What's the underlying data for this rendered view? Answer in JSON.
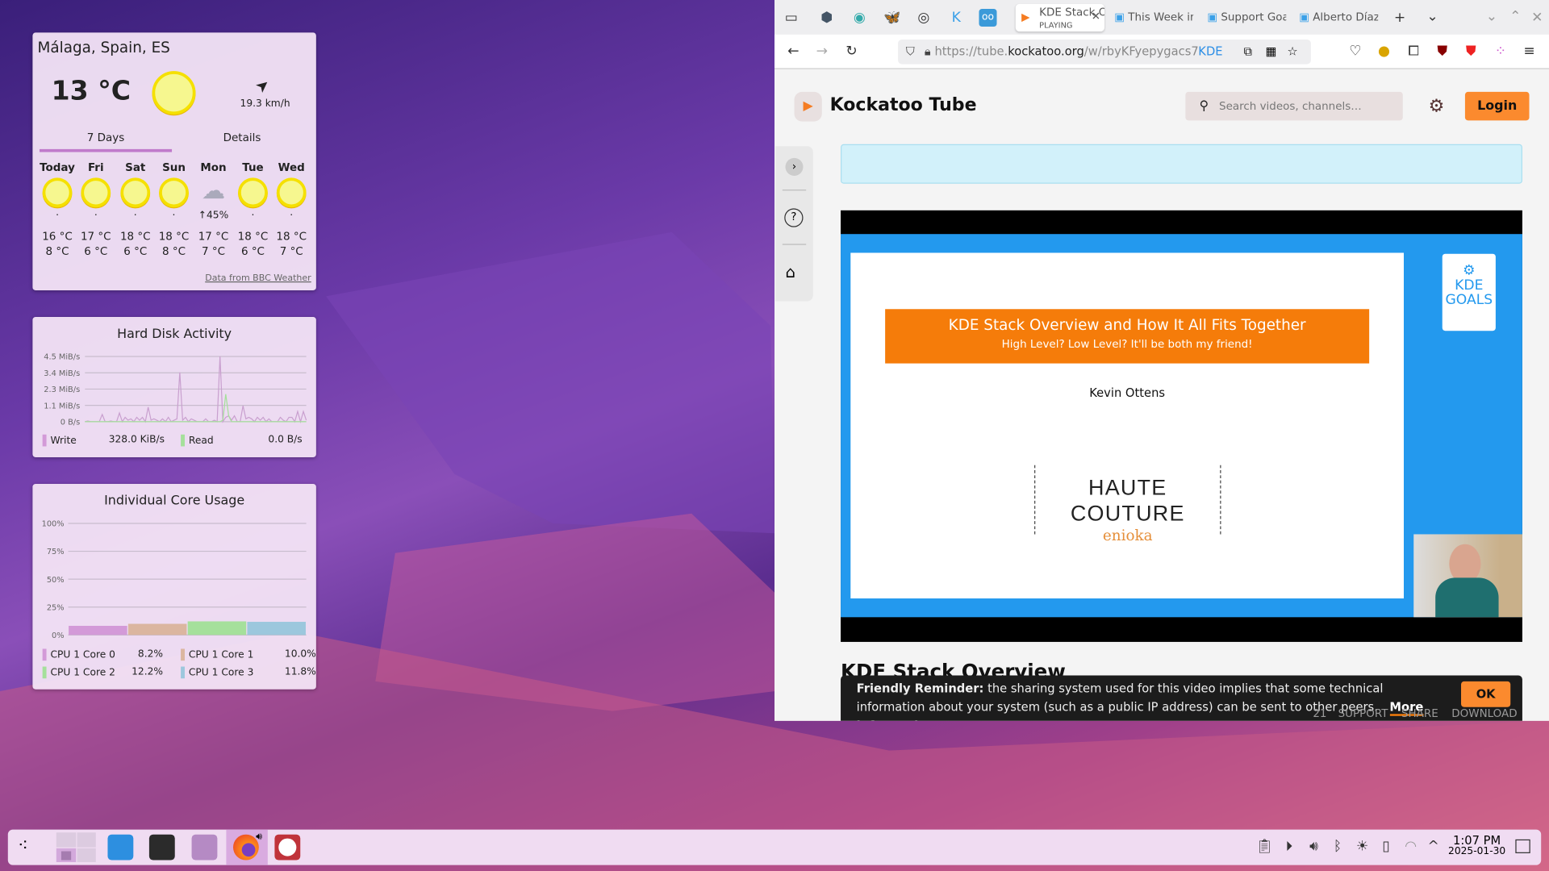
{
  "weather": {
    "location": "Málaga, Spain, ES",
    "temperature": "13 °C",
    "wind": "19.3 km/h",
    "tabs": [
      "7 Days",
      "Details"
    ],
    "days": [
      {
        "name": "Today",
        "icon": "sun-icon",
        "precip": "·",
        "high": "16 °C",
        "low": "8 °C"
      },
      {
        "name": "Fri",
        "icon": "sun-icon",
        "precip": "·",
        "high": "17 °C",
        "low": "6 °C"
      },
      {
        "name": "Sat",
        "icon": "sun-icon",
        "precip": "·",
        "high": "18 °C",
        "low": "6 °C"
      },
      {
        "name": "Sun",
        "icon": "sun-icon",
        "precip": "·",
        "high": "18 °C",
        "low": "8 °C"
      },
      {
        "name": "Mon",
        "icon": "rain-cloud-icon",
        "precip": "↑45%",
        "high": "17 °C",
        "low": "7 °C"
      },
      {
        "name": "Tue",
        "icon": "sun-icon",
        "precip": "·",
        "high": "18 °C",
        "low": "6 °C"
      },
      {
        "name": "Wed",
        "icon": "sun-icon",
        "precip": "·",
        "high": "18 °C",
        "low": "7 °C"
      }
    ],
    "source": "Data from BBC Weather"
  },
  "disk": {
    "title": "Hard Disk Activity",
    "yticks": [
      "4.5 MiB/s",
      "3.4 MiB/s",
      "2.3 MiB/s",
      "1.1 MiB/s",
      "0 B/s"
    ],
    "ymax": 4.5,
    "write": [
      0,
      0.05,
      0,
      0,
      0,
      0,
      0.5,
      0,
      0,
      0.05,
      0,
      0,
      0.6,
      0,
      0.3,
      0.1,
      0.2,
      0,
      0.3,
      0.1,
      0.3,
      0,
      1.0,
      0.1,
      0.2,
      0.1,
      0,
      0.2,
      0,
      0.3,
      0,
      0.1,
      0.2,
      3.4,
      0.1,
      0.3,
      0,
      0.2,
      0.1,
      0,
      0,
      0,
      0.2,
      0,
      0,
      0.1,
      0,
      4.5,
      0,
      0.3,
      0.4,
      0.1,
      0.4,
      0,
      0,
      1.1,
      0.2,
      0.3,
      0.2,
      0,
      0.3,
      0.1,
      0.3,
      0,
      0.2,
      0,
      0,
      0,
      0.3,
      0.1,
      0,
      0.3,
      0.3,
      0,
      0.7,
      0,
      0.7,
      0.1
    ],
    "read": [
      0,
      0,
      0,
      0,
      0,
      0,
      0,
      0,
      0,
      0,
      0,
      0,
      0,
      0,
      0,
      0,
      0,
      0,
      0,
      0,
      0,
      0,
      0,
      0,
      0,
      0,
      0,
      0,
      0,
      0,
      0,
      0,
      0,
      0,
      0,
      0,
      0,
      0,
      0,
      0,
      0,
      0,
      0,
      0,
      0,
      0,
      0,
      0,
      0.1,
      1.9,
      0.4,
      0,
      0,
      0,
      0,
      0,
      0,
      0,
      0,
      0,
      0,
      0,
      0,
      0,
      0,
      0,
      0,
      0,
      0,
      0,
      0,
      0,
      0,
      0,
      0,
      0,
      0,
      0
    ],
    "legend": [
      {
        "label": "Write",
        "value": "328.0 KiB/s",
        "color": "#d39ad8"
      },
      {
        "label": "Read",
        "value": "0.0 B/s",
        "color": "#a5e09b"
      }
    ]
  },
  "cores": {
    "title": "Individual Core Usage",
    "yticks": [
      "100%",
      "75%",
      "50%",
      "25%",
      "0%"
    ],
    "items": [
      {
        "label": "CPU 1 Core 0",
        "value": "8.2%",
        "pct": 8.2,
        "color": "#d39ad8"
      },
      {
        "label": "CPU 1 Core 1",
        "value": "10.0%",
        "pct": 10.0,
        "color": "#dbb6a0"
      },
      {
        "label": "CPU 1 Core 2",
        "value": "12.2%",
        "pct": 12.2,
        "color": "#a5e09b"
      },
      {
        "label": "CPU 1 Core 3",
        "value": "11.8%",
        "pct": 11.8,
        "color": "#9cc7dd"
      }
    ]
  },
  "browser": {
    "tabs": [
      {
        "title": "KDE Stack Overview",
        "sub": "PLAYING"
      },
      {
        "title": "This Week in KDE"
      },
      {
        "title": "Support Goals"
      },
      {
        "title": "Alberto Díaz"
      }
    ],
    "url_prefix": "https://tube.",
    "url_domain": "kockatoo.org",
    "url_path": "/w/rbyKFyepygacs7T",
    "url_badge": "KDE",
    "site": {
      "name": "Kockatoo Tube",
      "search_placeholder": "Search videos, channels…",
      "login": "Login",
      "accent": "#fb8a2e"
    },
    "slide": {
      "title": "KDE Stack Overview and How It All Fits Together",
      "subtitle": "High Level? Low Level? It'll be both my friend!",
      "author": "Kevin Ottens",
      "logo_text": "HAUTE COUTURE",
      "logo_sub": "enioka",
      "kde_logo": "KDE GOALS"
    },
    "video_title": "KDE Stack Overview",
    "actions": {
      "likes": "21",
      "support": "SUPPORT",
      "share": "SHARE",
      "download": "DOWNLOAD"
    },
    "toast": {
      "bold": "Friendly Reminder:",
      "text": " the sharing system used for this video implies that some technical information about your system (such as a public IP address) can be sent to other peers.",
      "link": "More information",
      "ok": "OK"
    }
  },
  "taskbar": {
    "time": "1:07 PM",
    "date": "2025-01-30"
  }
}
